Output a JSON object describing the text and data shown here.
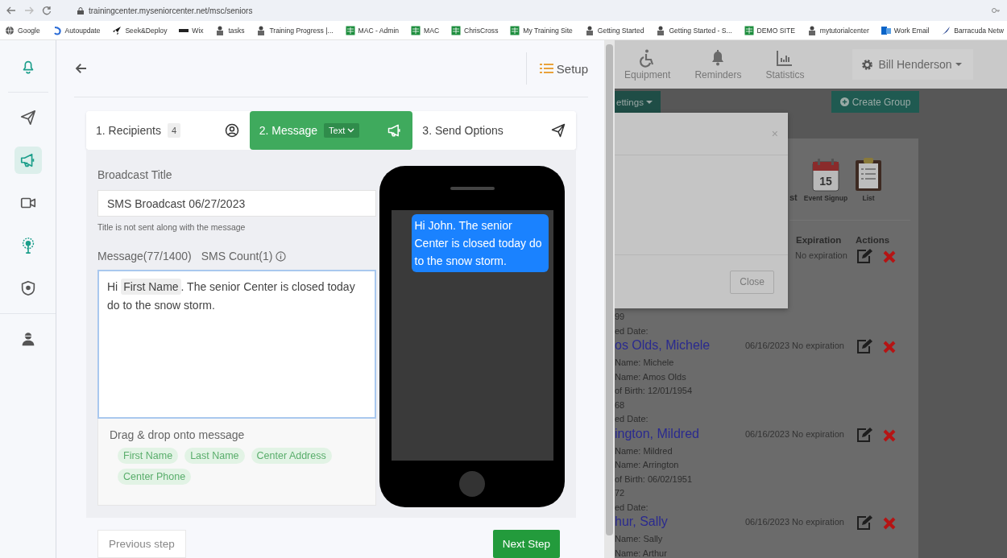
{
  "browser": {
    "url": "trainingcenter.myseniorcenter.net/msc/seniors",
    "bookmarks": [
      {
        "label": "Google",
        "kind": "globe"
      },
      {
        "label": "Autoupdate",
        "kind": "swirl"
      },
      {
        "label": "Seek&Deploy",
        "kind": "rocket"
      },
      {
        "label": "Wix",
        "kind": "wix"
      },
      {
        "label": "tasks",
        "kind": "person"
      },
      {
        "label": "Training Progress |...",
        "kind": "person"
      },
      {
        "label": "MAC - Admin",
        "kind": "sheet"
      },
      {
        "label": "MAC",
        "kind": "sheet"
      },
      {
        "label": "ChrisCross",
        "kind": "sheet"
      },
      {
        "label": "My Training Site",
        "kind": "sheet"
      },
      {
        "label": "Getting Started",
        "kind": "person"
      },
      {
        "label": "Getting Started - S...",
        "kind": "person"
      },
      {
        "label": "DEMO SITE",
        "kind": "sheet"
      },
      {
        "label": "mytutorialcenter",
        "kind": "person"
      },
      {
        "label": "Work Email",
        "kind": "mail"
      },
      {
        "label": "Barracuda Netw",
        "kind": "bird"
      }
    ]
  },
  "rail": {
    "groups": [
      {
        "items": [
          {
            "kind": "bell",
            "selected": false
          }
        ]
      },
      {
        "items": [
          {
            "kind": "plane",
            "selected": false
          },
          {
            "kind": "megaphone",
            "selected": true
          },
          {
            "kind": "video",
            "selected": false
          },
          {
            "kind": "tree",
            "selected": false
          },
          {
            "kind": "shield",
            "selected": false
          }
        ]
      },
      {
        "items": [
          {
            "kind": "user",
            "selected": false
          }
        ]
      }
    ]
  },
  "header": {
    "setup": "Setup"
  },
  "steps": [
    {
      "label": "1. Recipients",
      "badge": "4",
      "selected": false
    },
    {
      "label": "2. Message",
      "dropdown": "Text",
      "selected": true
    },
    {
      "label": "3. Send Options",
      "selected": false
    }
  ],
  "form": {
    "title_label": "Broadcast Title",
    "title_value": "SMS Broadcast 06/27/2023",
    "title_hint": "Title is not sent along with the message",
    "message_label": "Message(77/1400)",
    "sms_count": "SMS Count(1)",
    "message": {
      "before": "Hi",
      "token": "First Name",
      "after": ". The senior Center is closed today do to the snow storm."
    },
    "drag_label": "Drag & drop onto message",
    "tokens": [
      "First Name",
      "Last Name",
      "Center Address",
      "Center Phone"
    ]
  },
  "preview": {
    "bubble": "Hi John. The senior Center is closed today do to the snow storm."
  },
  "footer": {
    "previous": "Previous step",
    "next": "Next Step"
  },
  "background_page": {
    "nav": [
      {
        "label": "Equipment"
      },
      {
        "label": "Reminders"
      },
      {
        "label": "Statistics"
      }
    ],
    "user": "Bill Henderson",
    "settings_button": "ettings",
    "create_group": "Create Group",
    "modal": {
      "close_icon": "×",
      "close_button": "Close"
    },
    "tiles": [
      {
        "label": "st",
        "kind": "cut"
      },
      {
        "label": "Event Signup",
        "kind": "calendar",
        "day": "15"
      },
      {
        "label": "List",
        "kind": "clipboard"
      }
    ],
    "columns": [
      "Expiration",
      "Actions"
    ],
    "records": [
      {
        "date": "No expiration",
        "lines": [
          "99",
          "ed Date:"
        ]
      },
      {
        "name": "os Olds, Michele",
        "date": "06/16/2023 No expiration",
        "lines": [
          "Name: Michele",
          "Name: Amos Olds",
          "of Birth: 12/01/1954",
          "68",
          "ed Date:"
        ]
      },
      {
        "name": "ington, Mildred",
        "date": "06/16/2023 No expiration",
        "lines": [
          "Name: Mildred",
          "Name: Arrington",
          "of Birth: 06/02/1951",
          "72",
          "ed Date:"
        ]
      },
      {
        "name": "hur, Sally",
        "date": "06/16/2023 No expiration",
        "lines": [
          "Name: Sally",
          "Name: Arthur"
        ]
      }
    ]
  }
}
